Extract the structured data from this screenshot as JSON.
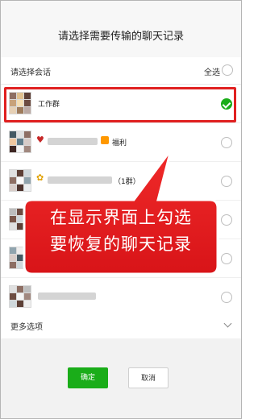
{
  "header": {
    "title": "请选择需要传输的聊天记录"
  },
  "select_bar": {
    "label": "请选择会话",
    "select_all": "全选"
  },
  "chats": [
    {
      "name": "工作群",
      "checked": true
    },
    {
      "name": "福利",
      "checked": false
    },
    {
      "name": "（1群）",
      "checked": false
    }
  ],
  "more_options": {
    "label": "更多选项"
  },
  "buttons": {
    "ok": "确定",
    "cancel": "取消"
  },
  "callout": {
    "line1": "在显示界面上勾选",
    "line2": "要恢复的聊天记录"
  },
  "colors": {
    "accent": "#1aad19",
    "callout": "#e31e24",
    "highlight_border": "#e02020"
  }
}
